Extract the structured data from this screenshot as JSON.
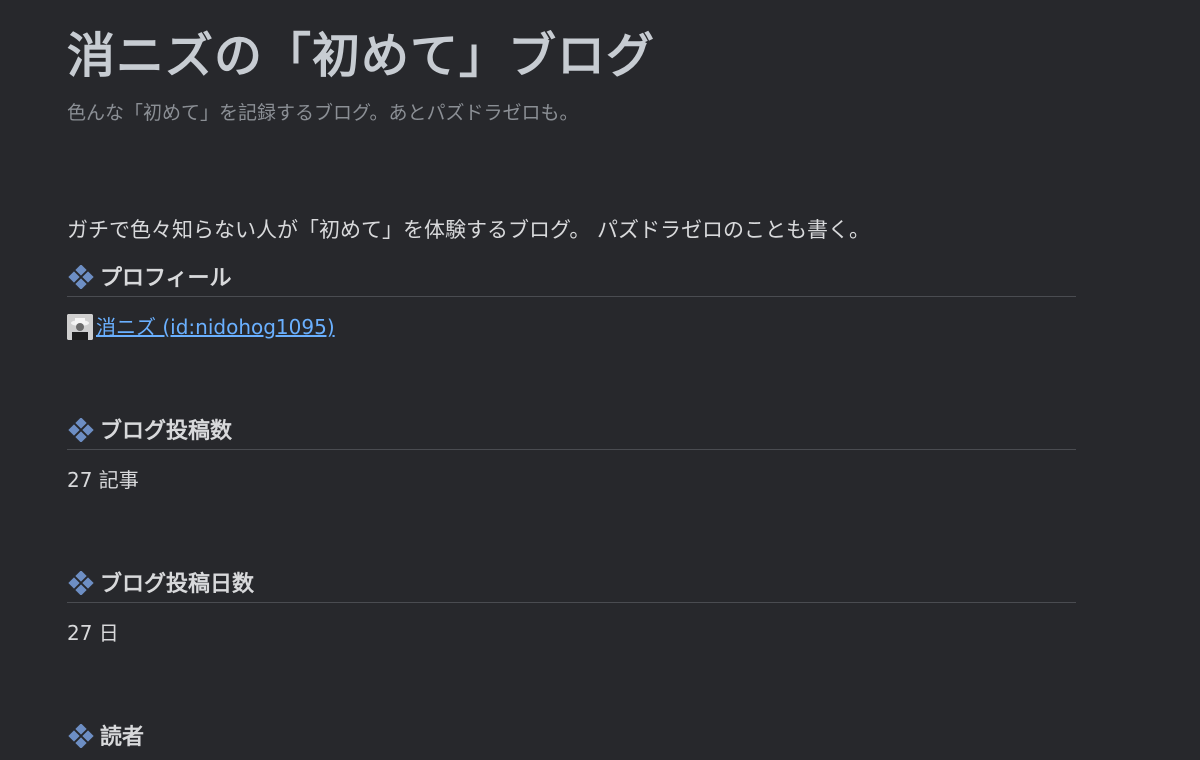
{
  "header": {
    "title": "消ニズの「初めて」ブログ",
    "subtitle": "色んな「初めて」を記録するブログ。あとパズドラゼロも。"
  },
  "description": "ガチで色々知らない人が「初めて」を体験するブログ。 パズドラゼロのことも書く。",
  "sections": [
    {
      "heading": "プロフィール",
      "icon": "diamond-dots-icon"
    },
    {
      "heading": "ブログ投稿数",
      "icon": "diamond-dots-icon"
    },
    {
      "heading": "ブログ投稿日数",
      "icon": "diamond-dots-icon"
    },
    {
      "heading": "読者",
      "icon": "diamond-dots-icon"
    }
  ],
  "profile": {
    "link_text": "消ニズ (id:nidohog1095)",
    "avatar": "user-avatar-icon"
  },
  "post_count": "27 記事",
  "post_days": "27 日",
  "colors": {
    "background": "#27282c",
    "accent_icon": "#6d8ec4",
    "link": "#6ab0ff"
  }
}
